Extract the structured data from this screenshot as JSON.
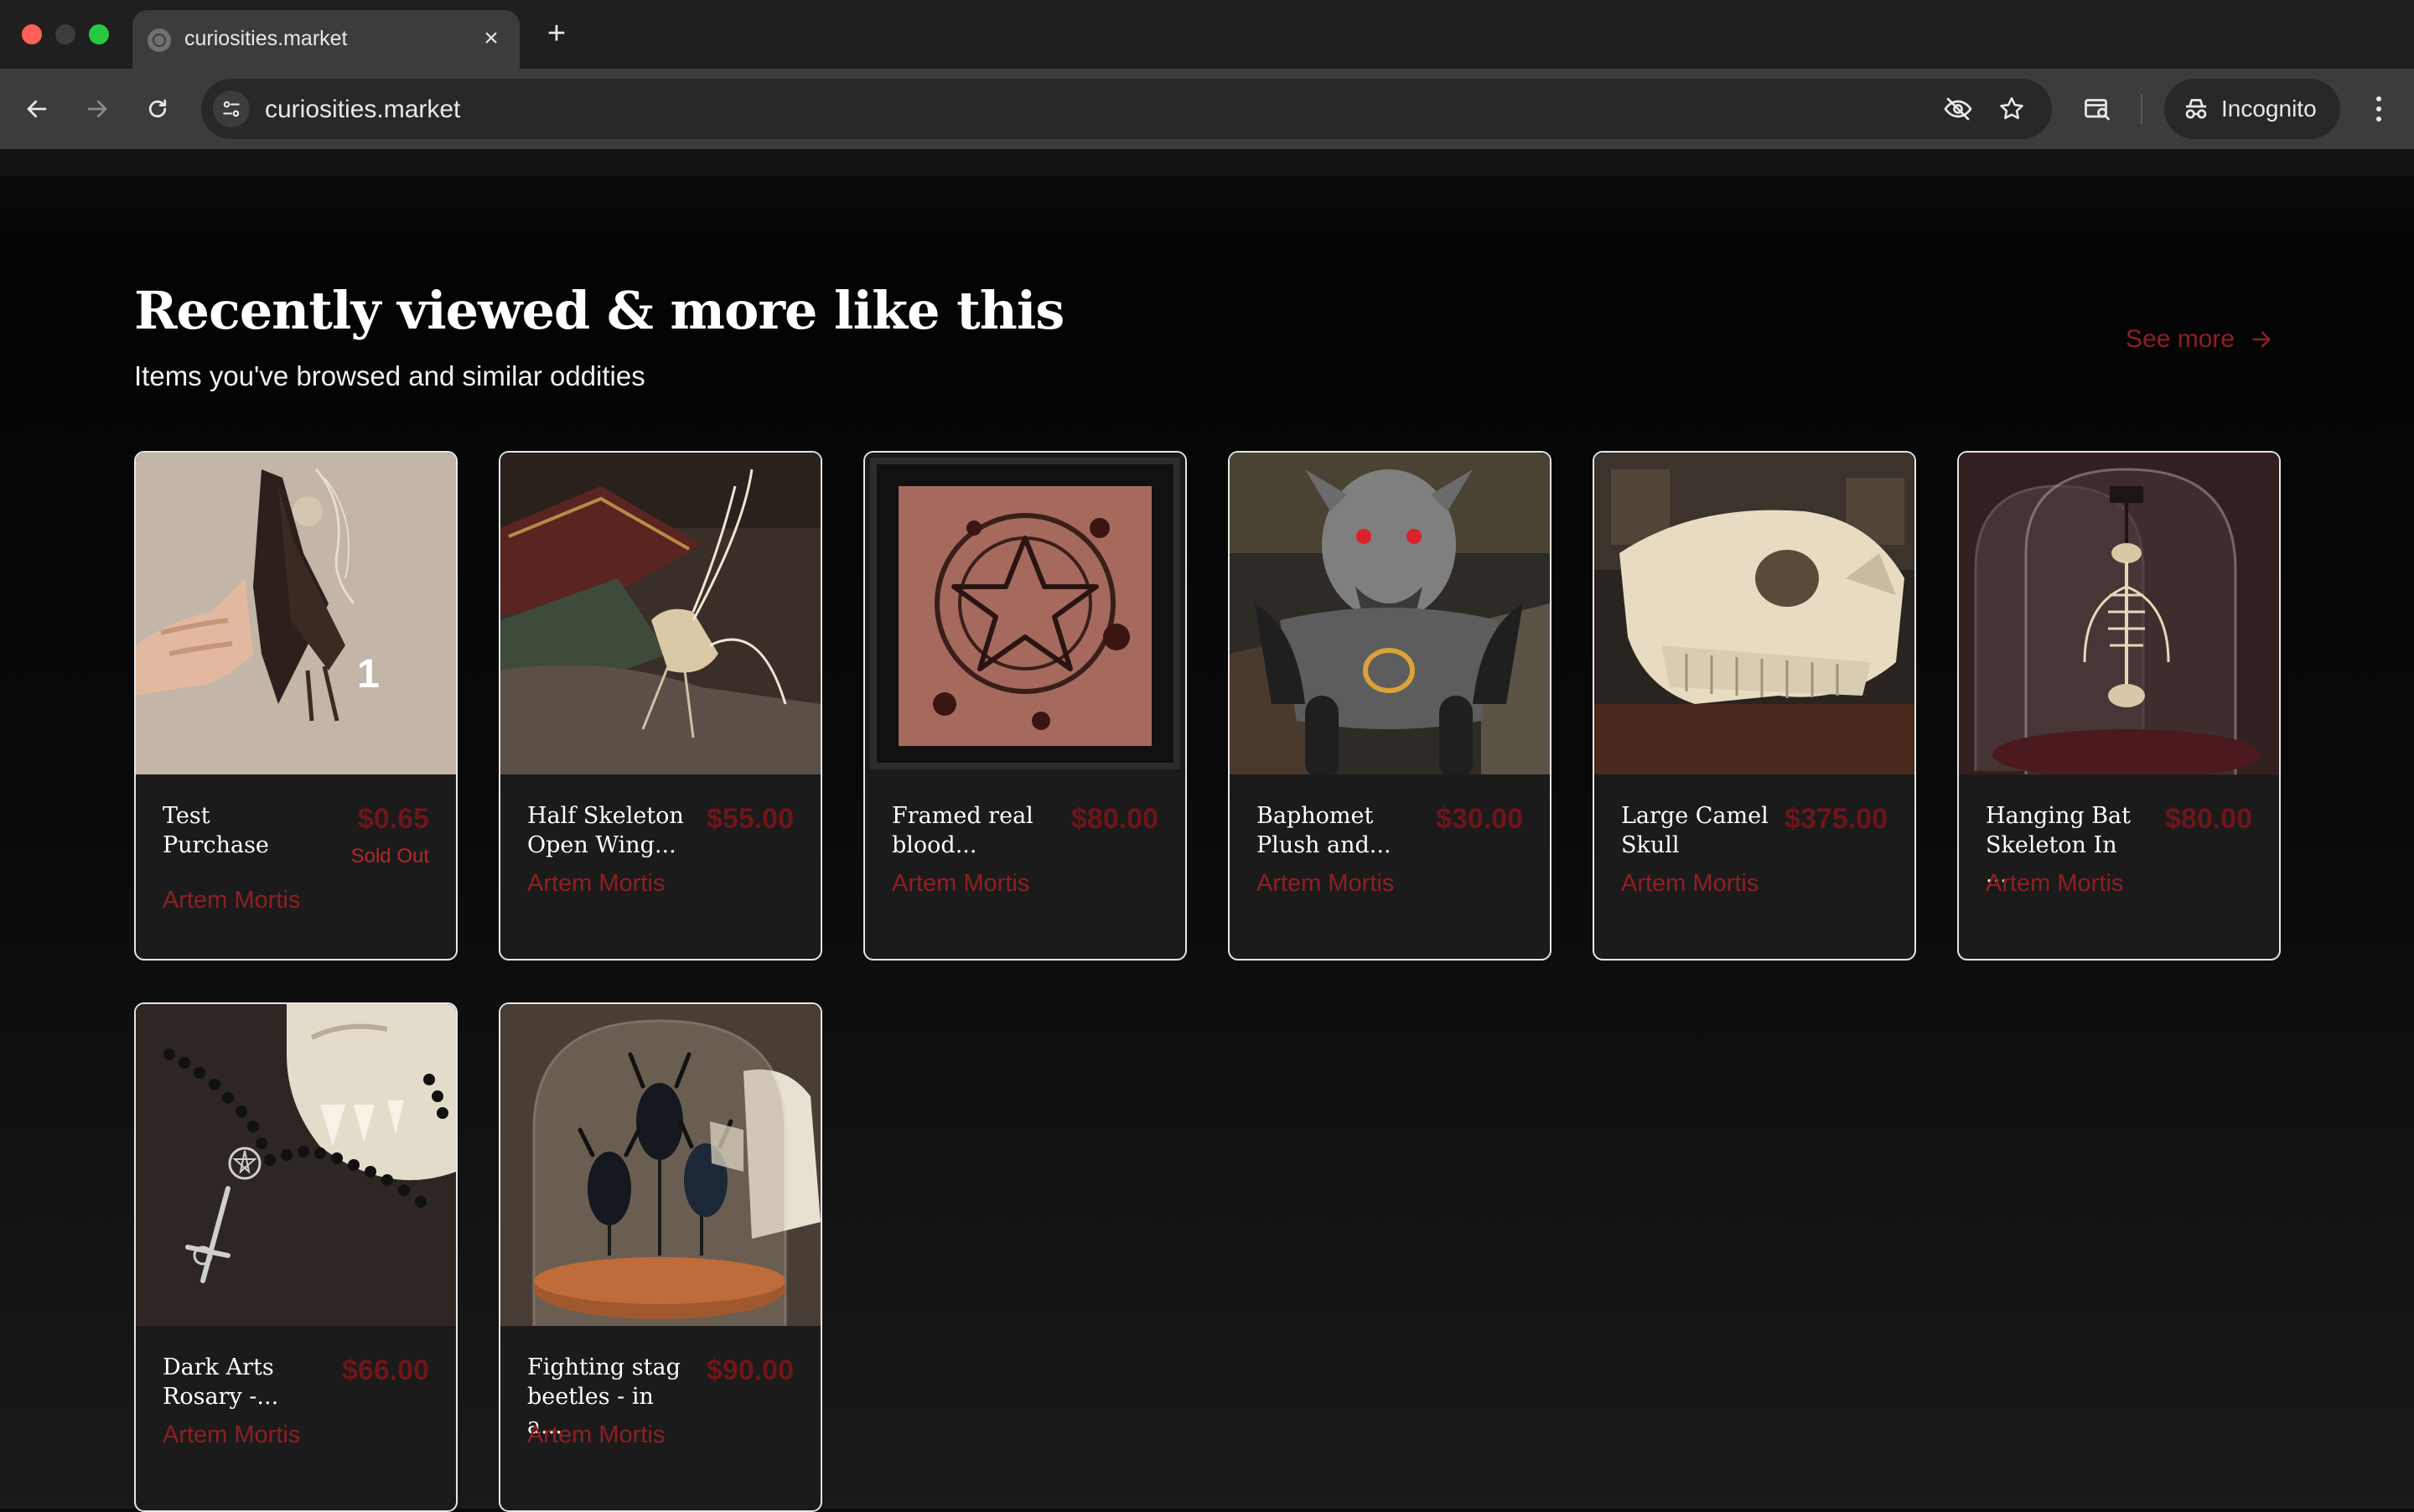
{
  "browser": {
    "tab_title": "curiosities.market",
    "url": "curiosities.market",
    "profile_label": "Incognito"
  },
  "section": {
    "title": "Recently viewed & more like this",
    "subtitle": "Items you've browsed and similar oddities",
    "see_more": "See more"
  },
  "products": [
    {
      "name": "Test Purchase",
      "price": "$0.65",
      "status": "Sold Out",
      "vendor": "Artem Mortis",
      "image": "bat-in-hand"
    },
    {
      "name": "Half Skeleton Open Wing...",
      "price": "$55.00",
      "vendor": "Artem Mortis",
      "image": "half-skeleton-bat"
    },
    {
      "name": "Framed real blood...",
      "price": "$80.00",
      "vendor": "Artem Mortis",
      "image": "framed-pentagram"
    },
    {
      "name": "Baphomet Plush and...",
      "price": "$30.00",
      "vendor": "Artem Mortis",
      "image": "baphomet-plush"
    },
    {
      "name": "Large Camel Skull",
      "price": "$375.00",
      "vendor": "Artem Mortis",
      "image": "camel-skull"
    },
    {
      "name": "Hanging Bat Skeleton In ...",
      "price": "$80.00",
      "vendor": "Artem Mortis",
      "image": "bat-skeleton-dome"
    },
    {
      "name": "Dark Arts Rosary -...",
      "price": "$66.00",
      "vendor": "Artem Mortis",
      "image": "rosary-skull"
    },
    {
      "name": "Fighting stag beetles - in a...",
      "price": "$90.00",
      "vendor": "Artem Mortis",
      "image": "stag-beetles-dome"
    }
  ],
  "badge_number": "1",
  "colors": {
    "accent": "#8e1f24",
    "price": "#6e1519",
    "card_bg": "#1b1b1b",
    "page_bg": "#0a0a0a"
  }
}
